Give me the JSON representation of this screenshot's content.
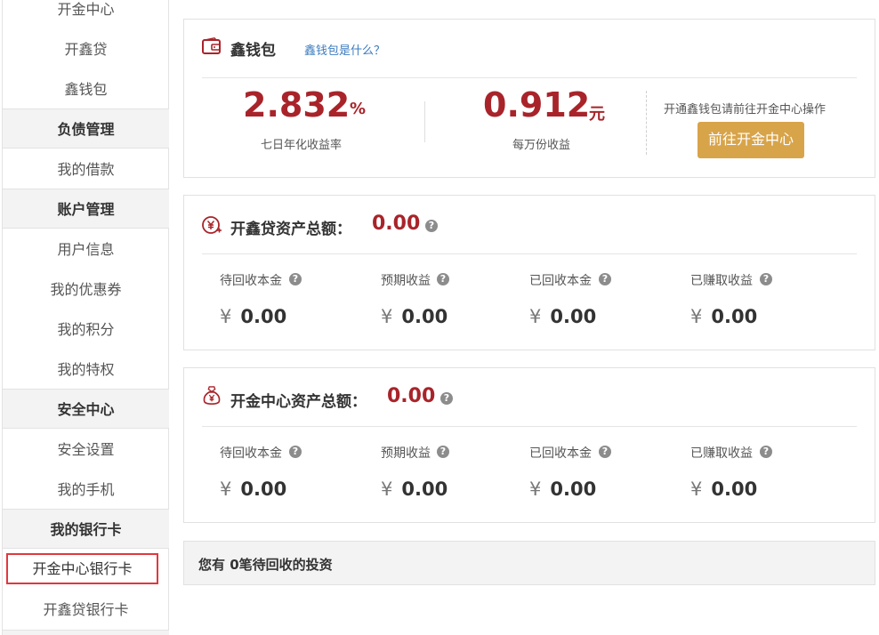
{
  "sidebar": {
    "items": [
      {
        "label": "开金中心",
        "type": "item"
      },
      {
        "label": "开鑫贷",
        "type": "item"
      },
      {
        "label": "鑫钱包",
        "type": "item"
      },
      {
        "label": "负债管理",
        "type": "head"
      },
      {
        "label": "我的借款",
        "type": "item"
      },
      {
        "label": "账户管理",
        "type": "head"
      },
      {
        "label": "用户信息",
        "type": "item"
      },
      {
        "label": "我的优惠券",
        "type": "item"
      },
      {
        "label": "我的积分",
        "type": "item"
      },
      {
        "label": "我的特权",
        "type": "item"
      },
      {
        "label": "安全中心",
        "type": "head"
      },
      {
        "label": "安全设置",
        "type": "item"
      },
      {
        "label": "我的手机",
        "type": "item"
      },
      {
        "label": "我的银行卡",
        "type": "head"
      },
      {
        "label": "开金中心银行卡",
        "type": "active"
      },
      {
        "label": "开鑫贷银行卡",
        "type": "item"
      }
    ]
  },
  "wallet": {
    "title": "鑫钱包",
    "link": "鑫钱包是什么？",
    "rate_value": "2.832",
    "rate_unit": "%",
    "rate_label": "七日年化收益率",
    "income_value": "0.912",
    "income_unit": "元",
    "income_label": "每万份收益",
    "goto_text": "开通鑫钱包请前往开金中心操作",
    "goto_button": "前往开金中心"
  },
  "kxd": {
    "title": "开鑫贷资产总额：",
    "total": "0.00",
    "stats": [
      {
        "label": "待回收本金",
        "value": "0.00"
      },
      {
        "label": "预期收益",
        "value": "0.00"
      },
      {
        "label": "已回收本金",
        "value": "0.00"
      },
      {
        "label": "已赚取收益",
        "value": "0.00"
      }
    ]
  },
  "kjzx": {
    "title": "开金中心资产总额：",
    "total": "0.00",
    "stats": [
      {
        "label": "待回收本金",
        "value": "0.00"
      },
      {
        "label": "预期收益",
        "value": "0.00"
      },
      {
        "label": "已回收本金",
        "value": "0.00"
      },
      {
        "label": "已赚取收益",
        "value": "0.00"
      }
    ]
  },
  "currency_symbol": "¥",
  "help_glyph": "?",
  "pending": "您有 0笔待回收的投资",
  "colors": {
    "accent_red": "#a8242a",
    "button_gold": "#d8a44a",
    "link_blue": "#3a7bbf",
    "highlight_border": "#e0383e"
  }
}
